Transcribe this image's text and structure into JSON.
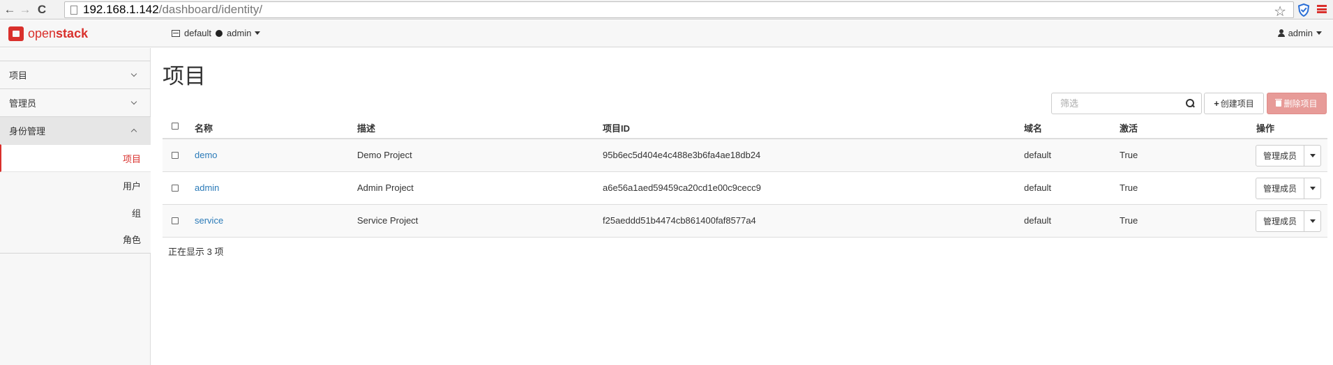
{
  "browser": {
    "url_host": "192.168.1.142",
    "url_path": "/dashboard/identity/",
    "back_glyph": "←",
    "forward_glyph": "→",
    "reload_glyph": "C",
    "star_glyph": "☆"
  },
  "topnav": {
    "brand_open": "open",
    "brand_stack": "stack",
    "domain": "default",
    "project": "admin",
    "user": "admin"
  },
  "sidebar": {
    "groups": [
      {
        "label": "项目",
        "expanded": false
      },
      {
        "label": "管理员",
        "expanded": false
      },
      {
        "label": "身份管理",
        "expanded": true
      }
    ],
    "identity_items": [
      {
        "label": "项目",
        "active": true
      },
      {
        "label": "用户",
        "active": false
      },
      {
        "label": "组",
        "active": false
      },
      {
        "label": "角色",
        "active": false
      }
    ]
  },
  "main": {
    "title": "项目",
    "filter_placeholder": "筛选",
    "create_label": "创建项目",
    "delete_label": "删除项目",
    "columns": {
      "name": "名称",
      "description": "描述",
      "project_id": "项目ID",
      "domain": "域名",
      "enabled": "激活",
      "actions": "操作"
    },
    "rows": [
      {
        "name": "demo",
        "description": "Demo Project",
        "project_id": "95b6ec5d404e4c488e3b6fa4ae18db24",
        "domain": "default",
        "enabled": "True",
        "action": "管理成员"
      },
      {
        "name": "admin",
        "description": "Admin Project",
        "project_id": "a6e56a1aed59459ca20cd1e00c9cecc9",
        "domain": "default",
        "enabled": "True",
        "action": "管理成员"
      },
      {
        "name": "service",
        "description": "Service Project",
        "project_id": "f25aeddd51b4474cb861400faf8577a4",
        "domain": "default",
        "enabled": "True",
        "action": "管理成员"
      }
    ],
    "footer": "正在显示 3 项"
  },
  "colors": {
    "brand_red": "#d9302c",
    "link_blue": "#2a7ab8",
    "delete_button_bg": "#e79b98"
  }
}
